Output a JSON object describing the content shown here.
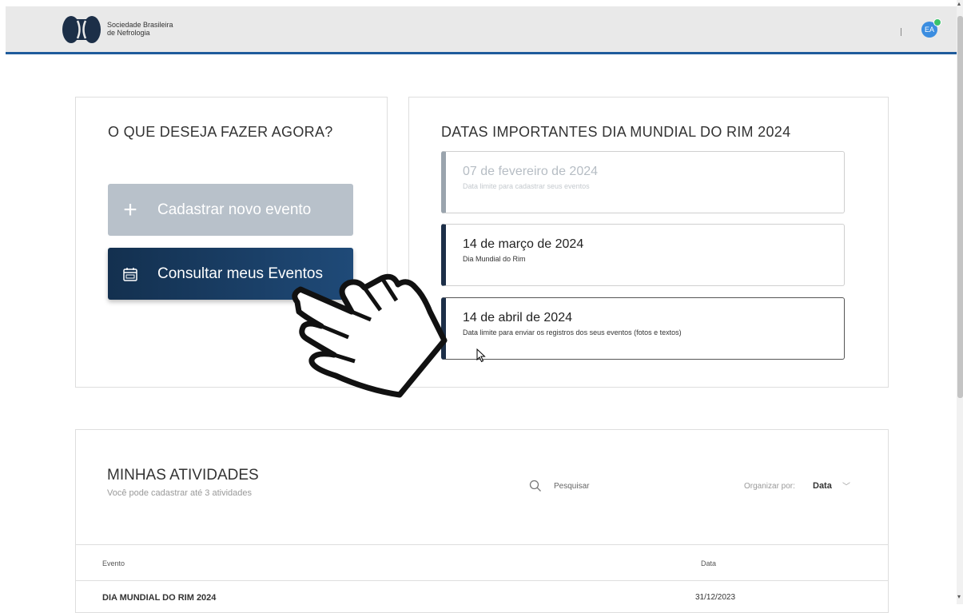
{
  "header": {
    "org_name_line1": "Sociedade Brasileira",
    "org_name_line2": "de Nefrologia",
    "avatar_initials": "EA"
  },
  "actions": {
    "title": "O QUE DESEJA FAZER AGORA?",
    "new_event_label": "Cadastrar novo evento",
    "my_events_label": "Consultar meus Eventos"
  },
  "dates": {
    "title": "DATAS IMPORTANTES DIA MUNDIAL DO RIM 2024",
    "items": [
      {
        "date": "07 de fevereiro de 2024",
        "desc": "Data limite para cadastrar seus eventos"
      },
      {
        "date": "14 de março de 2024",
        "desc": "Dia Mundial do Rim"
      },
      {
        "date": "14 de abril de 2024",
        "desc": "Data limite para enviar os registros dos seus eventos (fotos e textos)"
      }
    ]
  },
  "activities": {
    "title": "MINHAS ATIVIDADES",
    "subtitle": "Você pode cadastrar até 3 atividades",
    "search_placeholder": "Pesquisar",
    "sort_label": "Organizar por:",
    "sort_value": "Data",
    "columns": [
      "Evento",
      "Data"
    ],
    "rows": [
      {
        "evento": "DIA MUNDIAL DO RIM 2024",
        "data": "31/12/2023"
      }
    ]
  },
  "colors": {
    "header_accent": "#1f5b9c",
    "primary_dark": "#13304f",
    "disabled_button": "#b8c1ca"
  }
}
